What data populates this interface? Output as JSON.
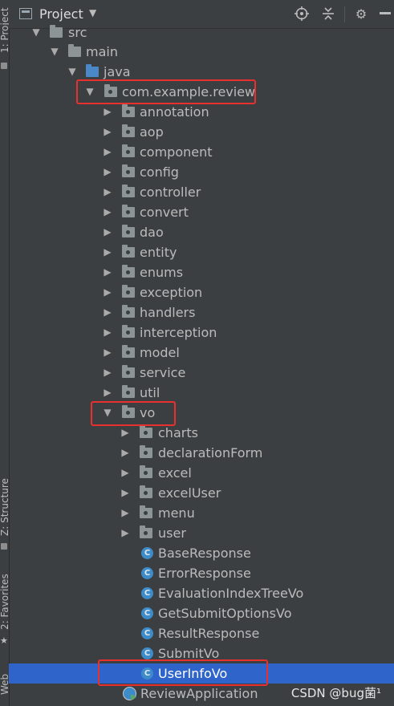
{
  "window": {
    "title": "Project",
    "icons": [
      "locate-icon",
      "collapse-icon",
      "settings-icon",
      "hide-icon"
    ]
  },
  "sidebar_tabs": {
    "project": "1: Project",
    "structure": "Z: Structure",
    "favorites": "2: Favorites",
    "web": "Web"
  },
  "tree": {
    "src": "src",
    "main": "main",
    "java": "java",
    "package": "com.example.review",
    "subpackages": [
      "annotation",
      "aop",
      "component",
      "config",
      "controller",
      "convert",
      "dao",
      "entity",
      "enums",
      "exception",
      "handlers",
      "interception",
      "model",
      "service",
      "util"
    ],
    "vo": "vo",
    "vo_packages": [
      "charts",
      "declarationForm",
      "excel",
      "excelUser",
      "menu",
      "user"
    ],
    "vo_classes": [
      "BaseResponse",
      "ErrorResponse",
      "EvaluationIndexTreeVo",
      "GetSubmitOptionsVo",
      "ResultResponse",
      "SubmitVo"
    ],
    "selected_class": "UserInfoVo",
    "app_class": "ReviewApplication"
  },
  "class_icon_letter": "C",
  "watermark": "CSDN @bug菌¹",
  "colors": {
    "background": "#3c3f41",
    "selection": "#2f65ca",
    "highlight_border": "#e8312f",
    "java_folder": "#4a88c7"
  }
}
